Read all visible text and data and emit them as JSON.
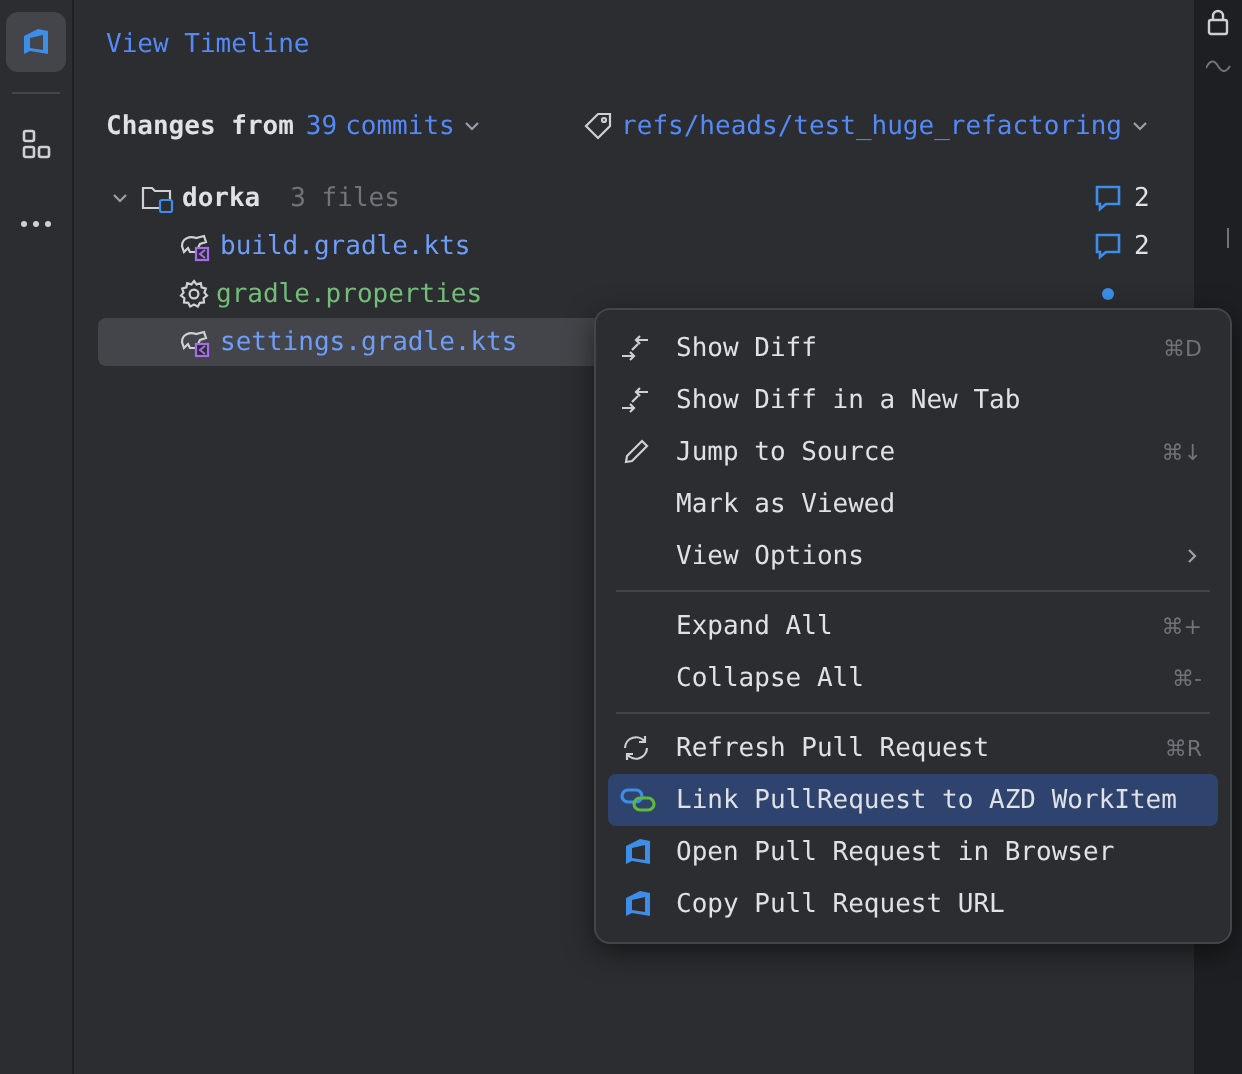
{
  "toolbar": {
    "items": [
      {
        "kind": "azure",
        "selected": true
      },
      {
        "kind": "structure",
        "selected": false
      },
      {
        "kind": "more",
        "selected": false
      }
    ]
  },
  "timeline_link": "View Timeline",
  "changes_header": {
    "label": "Changes from",
    "count": "39",
    "unit": "commits",
    "branch": "refs/heads/test_huge_refactoring"
  },
  "tree": [
    {
      "name": "dorka",
      "kind": "folder",
      "expanded": true,
      "meta": "3 files",
      "comments": "2",
      "selected": false,
      "children": [
        {
          "name": "build.gradle.kts",
          "kind": "kts",
          "color": "#6f9ef8",
          "comments": "2",
          "selected": false
        },
        {
          "name": "gradle.properties",
          "kind": "properties",
          "color": "#73bd79",
          "selected": false,
          "unread": true
        },
        {
          "name": "settings.gradle.kts",
          "kind": "kts",
          "color": "#6f9ef8",
          "selected": true
        }
      ]
    }
  ],
  "context_menu": {
    "items": [
      {
        "kind": "diff",
        "label": "Show Diff",
        "shortcut": "⌘D",
        "selected": false
      },
      {
        "kind": "diff",
        "label": "Show Diff in a New Tab",
        "selected": false
      },
      {
        "kind": "pencil",
        "label": "Jump to Source",
        "shortcut": "⌘↓",
        "selected": false
      },
      {
        "kind": "plain",
        "label": "Mark as Viewed",
        "selected": false
      },
      {
        "kind": "plain",
        "label": "View Options",
        "submenu": true,
        "selected": false
      },
      {
        "kind": "separator"
      },
      {
        "kind": "plain",
        "label": "Expand All",
        "shortcut": "⌘+",
        "selected": false
      },
      {
        "kind": "plain",
        "label": "Collapse All",
        "shortcut": "⌘-",
        "selected": false
      },
      {
        "kind": "separator"
      },
      {
        "kind": "refresh",
        "label": "Refresh Pull Request",
        "shortcut": "⌘R",
        "selected": false
      },
      {
        "kind": "link",
        "label": "Link PullRequest to AZD WorkItem",
        "selected": true
      },
      {
        "kind": "azure",
        "label": "Open Pull Request in Browser",
        "selected": false
      },
      {
        "kind": "azure",
        "label": "Copy Pull Request URL",
        "selected": false
      }
    ]
  }
}
